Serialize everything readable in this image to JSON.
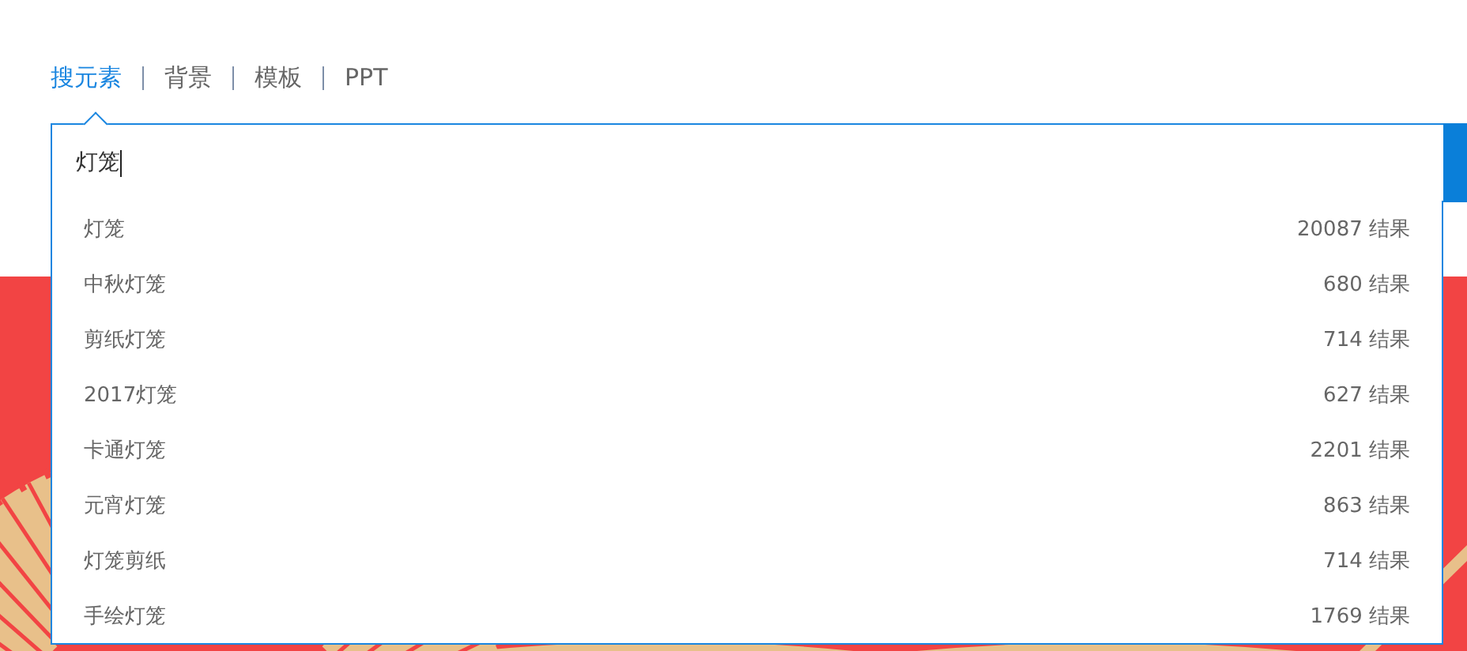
{
  "tabs": [
    {
      "label": "搜元素",
      "selected": true
    },
    {
      "label": "背景",
      "selected": false
    },
    {
      "label": "模板",
      "selected": false
    },
    {
      "label": "PPT",
      "selected": false
    }
  ],
  "search": {
    "value": "灯笼"
  },
  "suggestions": [
    {
      "term": "灯笼",
      "count": "20087 结果"
    },
    {
      "term": "中秋灯笼",
      "count": "680 结果"
    },
    {
      "term": "剪纸灯笼",
      "count": "714 结果"
    },
    {
      "term": "2017灯笼",
      "count": "627 结果"
    },
    {
      "term": "卡通灯笼",
      "count": "2201 结果"
    },
    {
      "term": "元宵灯笼",
      "count": "863 结果"
    },
    {
      "term": "灯笼剪纸",
      "count": "714 结果"
    },
    {
      "term": "手绘灯笼",
      "count": "1769 结果"
    }
  ]
}
